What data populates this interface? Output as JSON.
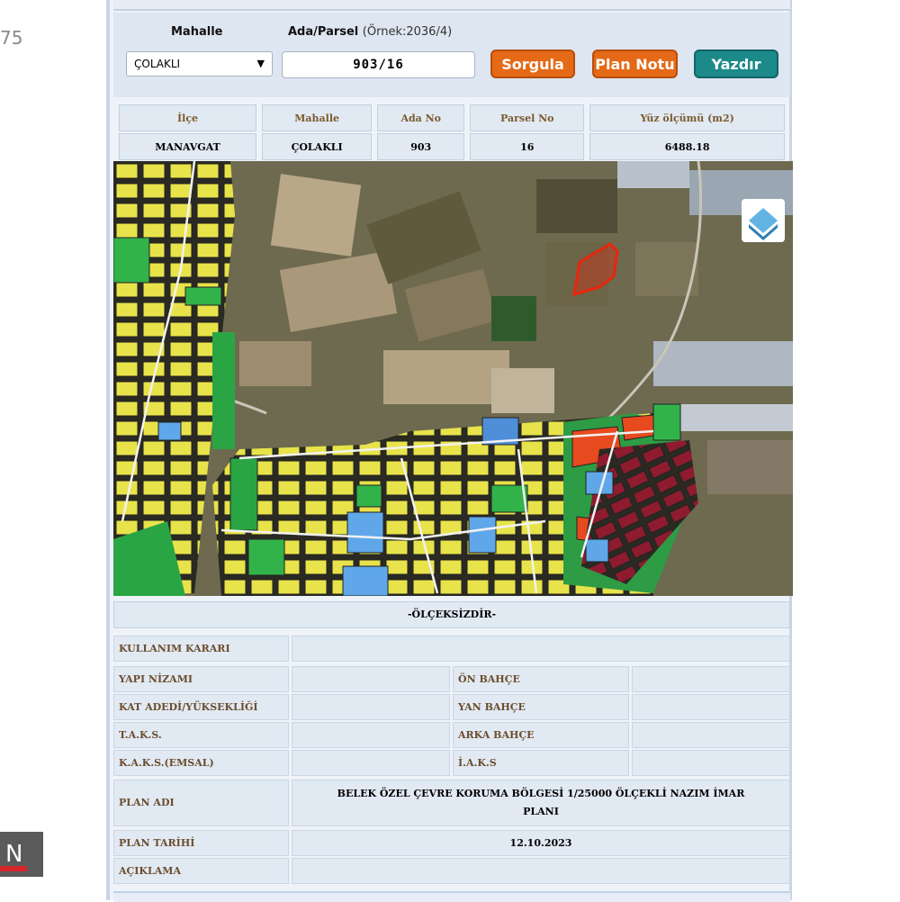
{
  "side": {
    "counter_text": "75",
    "logo_text": "N"
  },
  "query": {
    "mahalle_label": "Mahalle",
    "ada_parsel_label": "Ada/Parsel",
    "ada_parsel_hint": "(Örnek:2036/4)",
    "mahalle_value": "ÇOLAKLI",
    "ada_parsel_value": "903/16",
    "buttons": {
      "sorgula": "Sorgula",
      "plan_notu": "Plan Notu",
      "yazdir": "Yazdır"
    }
  },
  "info_table": {
    "headers": [
      "İlçe",
      "Mahalle",
      "Ada No",
      "Parsel No",
      "Yüz ölçümü (m2)"
    ],
    "values": [
      "MANAVGAT",
      "ÇOLAKLI",
      "903",
      "16",
      "6488.18"
    ]
  },
  "map": {
    "scale_note": "-ÖLÇEKSİZDİR-",
    "layers_icon": "layers-icon"
  },
  "details": {
    "kullanim_karari": {
      "label": "KULLANIM KARARI",
      "value": ""
    },
    "yapi_nizami": {
      "label": "YAPI NİZAMI",
      "value": ""
    },
    "on_bahce": {
      "label": "ÖN BAHÇE",
      "value": ""
    },
    "kat_adedi": {
      "label": "KAT ADEDİ/YÜKSEKLİĞİ",
      "value": ""
    },
    "yan_bahce": {
      "label": "YAN BAHÇE",
      "value": ""
    },
    "taks": {
      "label": "T.A.K.S.",
      "value": ""
    },
    "arka_bahce": {
      "label": "ARKA BAHÇE",
      "value": ""
    },
    "kaks": {
      "label": "K.A.K.S.(EMSAL)",
      "value": ""
    },
    "iaks": {
      "label": "İ.A.K.S",
      "value": ""
    },
    "plan_adi": {
      "label": "PLAN ADI",
      "value": "BELEK ÖZEL ÇEVRE KORUMA BÖLGESİ 1/25000 ÖLÇEKLİ NAZIM İMAR PLANI"
    },
    "plan_tarihi": {
      "label": "PLAN TARİHİ",
      "value": "12.10.2023"
    },
    "aciklama": {
      "label": "AÇIKLAMA",
      "value": ""
    }
  },
  "colors": {
    "panel_bg": "#eef3fa",
    "button_orange": "#e46a17",
    "button_teal": "#1d8a8a",
    "label_brown": "#6b4d2c",
    "parcel_highlight": "#e8260c"
  }
}
